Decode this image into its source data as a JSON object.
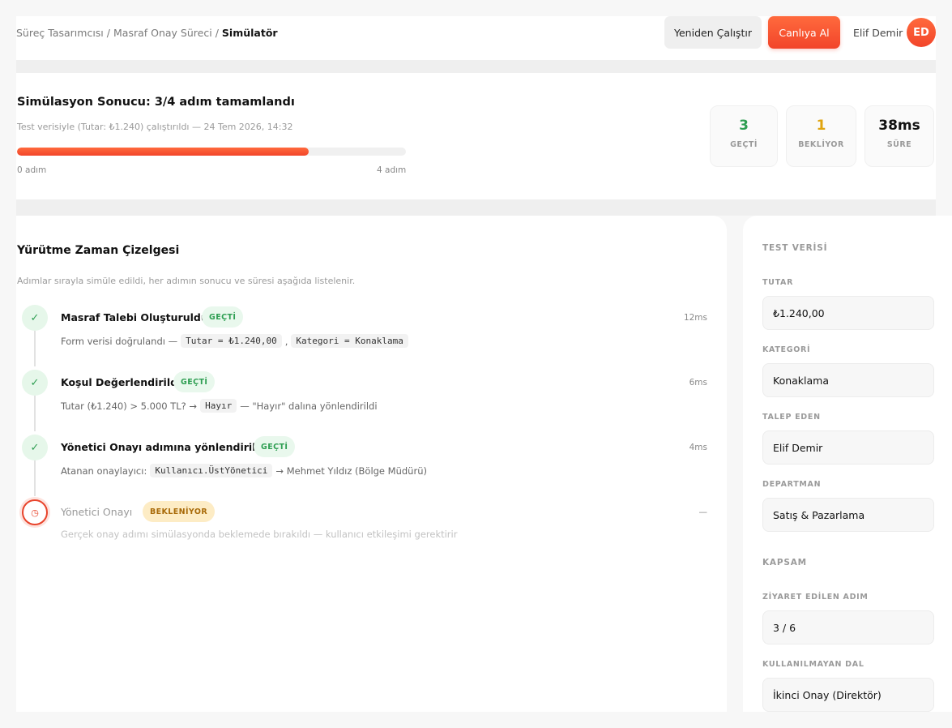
{
  "breadcrumb": {
    "items": [
      "Süreç Tasarımcısı",
      "Masraf Onay Süreci"
    ],
    "current": "Simülatör"
  },
  "header": {
    "rerun_label": "Yeniden Çalıştır",
    "deploy_label": "Canlıya Al",
    "user_name": "Elif Demir",
    "avatar_initials": "ED"
  },
  "summary": {
    "title": "Simülasyon Sonucu: 3/4 adım tamamlandı",
    "subtitle": "Test verisiyle (Tutar: ₺1.240) çalıştırıldı — 24 Tem 2026, 14:32",
    "progress_fraction": 0.75,
    "progress_min_label": "0 adım",
    "progress_max_label": "4 adım",
    "stats": [
      {
        "value": "3",
        "label": "GEÇTİ",
        "color": "#2e9e52"
      },
      {
        "value": "1",
        "label": "BEKLİYOR",
        "color": "#e0a40f"
      },
      {
        "value": "38ms",
        "label": "SÜRE",
        "color": "#111111"
      }
    ]
  },
  "timeline": {
    "title": "Yürütme Zaman Çizelgesi",
    "subtitle": "Adımlar sırayla simüle edildi, her adımın sonucu ve süresi aşağıda listelenir.",
    "steps": [
      {
        "title": "Masraf Talebi Oluşturuldu",
        "status": "GEÇTİ",
        "time": "12ms",
        "icon": "check-icon",
        "desc_prefix": "Form verisi doğrulandı —",
        "code1": "Tutar = ₺1.240,00",
        "desc_mid": ",",
        "code2": "Kategori = Konaklama"
      },
      {
        "title": "Koşul Değerlendirildi",
        "status": "GEÇTİ",
        "time": "6ms",
        "icon": "check-icon",
        "desc_prefix": "Tutar (₺1.240) > 5.000 TL? →",
        "code1": "Hayır",
        "desc_suffix": "— \"Hayır\" dalına yönlendirildi"
      },
      {
        "title": "Yönetici Onayı adımına yönlendirildi",
        "status": "GEÇTİ",
        "time": "4ms",
        "icon": "check-icon",
        "desc_prefix": "Atanan onaylayıcı:",
        "code1": "Kullanıcı.ÜstYönetici",
        "desc_suffix": "→ Mehmet Yıldız (Bölge Müdürü)"
      },
      {
        "title": "Yönetici Onayı",
        "status": "BEKLENİYOR",
        "time": "—",
        "icon": "clock-icon",
        "desc_prefix": "Gerçek onay adımı simülasyonda beklemede bırakıldı — kullanıcı etkileşimi gerektirir"
      }
    ]
  },
  "test_data": {
    "heading": "TEST VERİSİ",
    "fields": [
      {
        "label": "TUTAR",
        "value": "₺1.240,00"
      },
      {
        "label": "KATEGORİ",
        "value": "Konaklama"
      },
      {
        "label": "TALEP EDEN",
        "value": "Elif Demir"
      },
      {
        "label": "DEPARTMAN",
        "value": "Satış & Pazarlama"
      }
    ]
  },
  "coverage": {
    "heading": "KAPSAM",
    "fields": [
      {
        "label": "ZİYARET EDİLEN ADIM",
        "value": "3 / 6"
      },
      {
        "label": "KULLANILMAYAN DAL",
        "value": "İkinci Onay (Direktör)"
      }
    ]
  }
}
